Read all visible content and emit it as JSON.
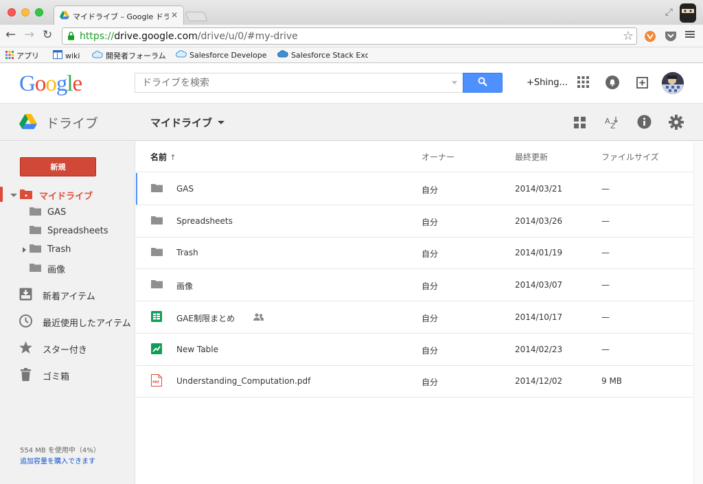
{
  "browser": {
    "tab_title": "マイドライブ – Google ドラ",
    "url_scheme": "https://",
    "url_host": "drive.google.com",
    "url_path": "/drive/u/0/#my-drive",
    "bookmarks": [
      {
        "label": "アプリ",
        "icon": "apps-grid-icon"
      },
      {
        "label": "wiki",
        "icon": "wiki-icon"
      },
      {
        "label": "開発者フォーラム",
        "icon": "cloud-icon"
      },
      {
        "label": "Salesforce Developer",
        "icon": "cloud-icon"
      },
      {
        "label": "Salesforce Stack Exch",
        "icon": "cloud-icon"
      }
    ]
  },
  "header": {
    "logo": "Google",
    "search_placeholder": "ドライブを検索",
    "user_name": "+Shing..."
  },
  "subbar": {
    "app_name": "ドライブ",
    "folder_title": "マイドライブ"
  },
  "sidebar": {
    "new_button": "新規",
    "my_drive": "マイドライブ",
    "folders": [
      "GAS",
      "Spreadsheets",
      "Trash",
      "画像"
    ],
    "items": [
      "新着アイテム",
      "最近使用したアイテム",
      "スター付き",
      "ゴミ箱"
    ],
    "storage_usage": "554 MB を使用中（4%）",
    "buy_storage": "追加容量を購入できます"
  },
  "list": {
    "columns": {
      "name": "名前",
      "owner": "オーナー",
      "modified": "最終更新",
      "size": "ファイルサイズ"
    },
    "sort_arrow": "↑",
    "rows": [
      {
        "name": "GAS",
        "type": "folder",
        "owner": "自分",
        "modified": "2014/03/21",
        "size": "—"
      },
      {
        "name": "Spreadsheets",
        "type": "folder",
        "owner": "自分",
        "modified": "2014/03/26",
        "size": "—"
      },
      {
        "name": "Trash",
        "type": "folder",
        "owner": "自分",
        "modified": "2014/01/19",
        "size": "—"
      },
      {
        "name": "画像",
        "type": "folder",
        "owner": "自分",
        "modified": "2014/03/07",
        "size": "—"
      },
      {
        "name": "GAE制限まとめ",
        "type": "spreadsheet",
        "owner": "自分",
        "modified": "2014/10/17",
        "size": "—"
      },
      {
        "name": "New Table",
        "type": "fusion-table",
        "owner": "自分",
        "modified": "2014/02/23",
        "size": "—"
      },
      {
        "name": "Understanding_Computation.pdf",
        "type": "pdf",
        "owner": "自分",
        "modified": "2014/12/02",
        "size": "9 MB"
      }
    ]
  },
  "colors": {
    "accent_red": "#dd4b39",
    "search_blue": "#4d90fe",
    "link_blue": "#1155cc"
  }
}
